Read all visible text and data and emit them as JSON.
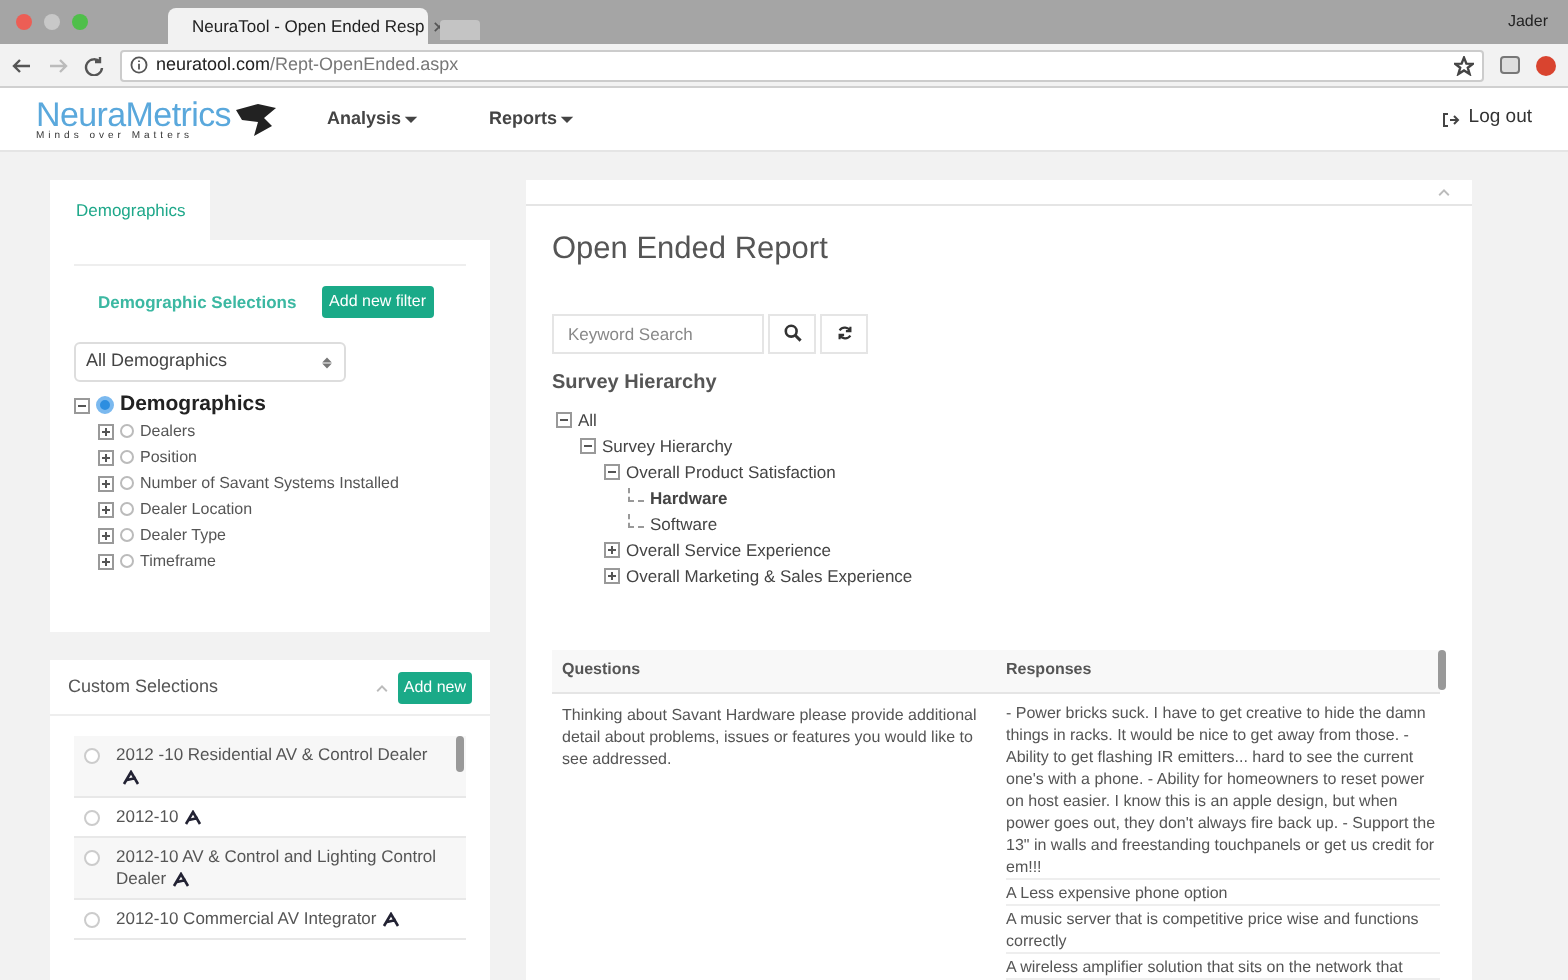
{
  "browser": {
    "tab_title": "NeuraTool - Open Ended Resp",
    "user": "Jader",
    "url_host": "neuratool.com",
    "url_path": "/Rept-OpenEnded.aspx"
  },
  "navbar": {
    "logo": "NeuraMetrics",
    "tagline": "Minds over Matters",
    "menus": [
      "Analysis",
      "Reports"
    ],
    "logout": "Log out"
  },
  "demographics_panel": {
    "tabs": [
      {
        "label": "Demographics",
        "selected": true
      }
    ],
    "heading": "Demographic Selections",
    "add_button": "Add new filter",
    "select_value": "All Demographics",
    "tree": [
      {
        "label": "Demographics",
        "selected": true,
        "expanded": true,
        "children": [
          {
            "label": "Dealers",
            "selected": false,
            "expanded": false
          },
          {
            "label": "Position",
            "selected": false,
            "expanded": false
          },
          {
            "label": "Number of Savant Systems Installed",
            "selected": false,
            "expanded": false
          },
          {
            "label": "Dealer Location",
            "selected": false,
            "expanded": false
          },
          {
            "label": "Dealer Type",
            "selected": false,
            "expanded": false
          },
          {
            "label": "Timeframe",
            "selected": false,
            "expanded": false
          }
        ]
      }
    ]
  },
  "custom_selections": {
    "title": "Custom Selections",
    "add_button": "Add new",
    "items": [
      {
        "label": "2012 -10 Residential AV & Control Dealer",
        "selected": false
      },
      {
        "label": "2012-10",
        "selected": false
      },
      {
        "label": "2012-10 AV & Control and Lighting Control Dealer",
        "selected": false
      },
      {
        "label": "2012-10 Commercial AV Integrator",
        "selected": false
      }
    ]
  },
  "report": {
    "title": "Open Ended Report",
    "search_placeholder": "Keyword Search",
    "hierarchy_title": "Survey Hierarchy",
    "tree": [
      {
        "label": "All",
        "expanded": true,
        "selected": false,
        "children": [
          {
            "label": "Survey Hierarchy",
            "expanded": true,
            "selected": false,
            "children": [
              {
                "label": "Overall Product Satisfaction",
                "expanded": true,
                "selected": false,
                "children": [
                  {
                    "label": "Hardware",
                    "selected": true
                  },
                  {
                    "label": "Software",
                    "selected": false
                  }
                ]
              },
              {
                "label": "Overall Service Experience",
                "expanded": false,
                "selected": false
              },
              {
                "label": "Overall Marketing & Sales Experience",
                "expanded": false,
                "selected": false
              }
            ]
          }
        ]
      }
    ],
    "table": {
      "columns": [
        "Questions",
        "Responses"
      ],
      "rows": [
        {
          "question": "Thinking about Savant Hardware please provide additional detail about problems, issues or features you would like to see addressed.",
          "responses": [
            "- Power bricks suck. I have to get creative to hide the damn things in racks. It would be nice to get away from those. - Ability to get flashing IR emitters... hard to see the current one's with a phone. - Ability for homeowners to reset power on host easier. I know this is an apple design, but when power goes out, they don't always fire back up. - Support the 13\" in walls and freestanding touchpanels or get us credit for em!!!",
            "A Less expensive phone option",
            "A music server that is competitive price wise and functions correctly",
            "A wireless amplifier solution that sits on the network that"
          ]
        }
      ]
    }
  }
}
